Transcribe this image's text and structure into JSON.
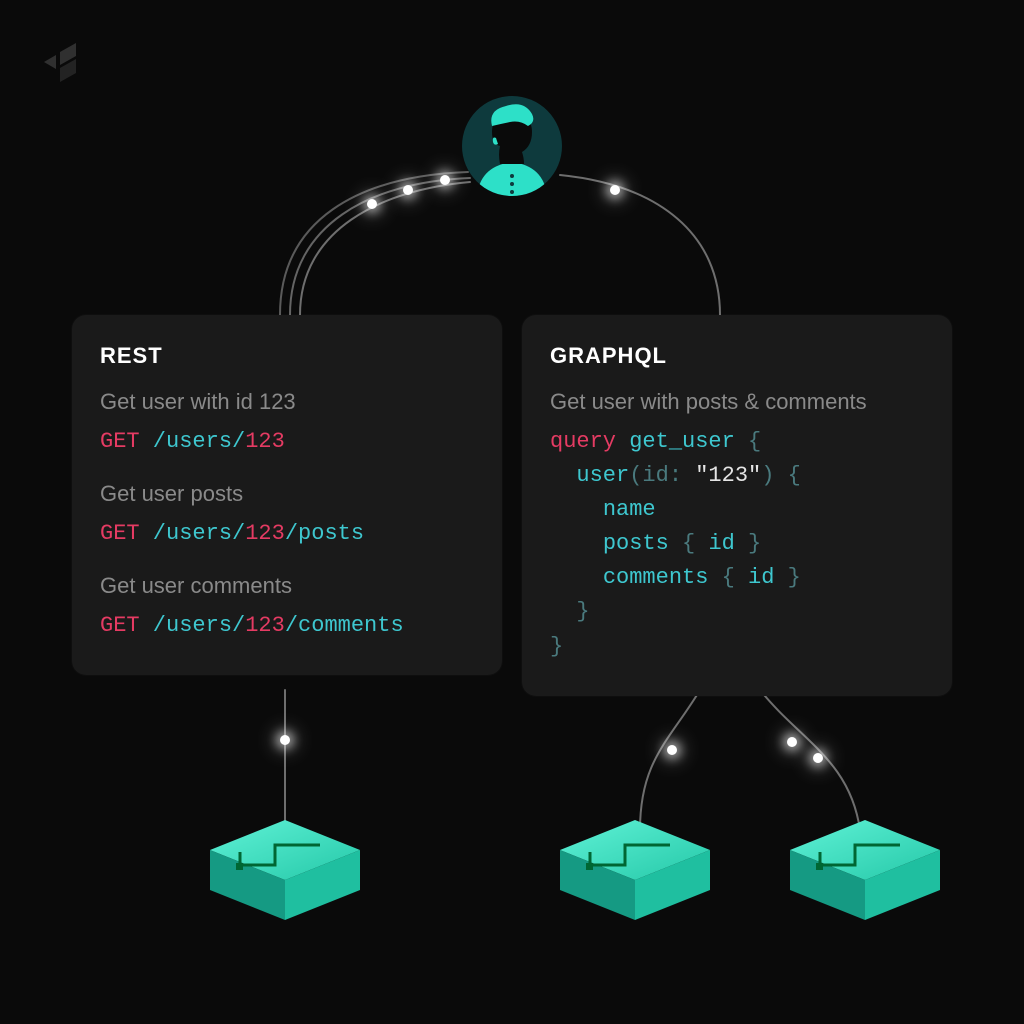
{
  "colors": {
    "bg": "#0a0a0a",
    "card_bg": "#1a1a1a",
    "text_muted": "#8a8a8a",
    "accent_red": "#e53b63",
    "accent_teal": "#3ec7cf",
    "brace": "#4a7a7e",
    "avatar_bg": "#0e3a3d",
    "avatar_accent": "#2de0c8",
    "server_top": "#3de9c8",
    "server_side": "#16a990"
  },
  "rest": {
    "title": "REST",
    "blocks": [
      {
        "desc": "Get user with id 123",
        "method": "GET",
        "segments": [
          " /users/",
          "123"
        ]
      },
      {
        "desc": "Get user posts",
        "method": "GET",
        "segments": [
          " /users/",
          "123",
          "/posts"
        ]
      },
      {
        "desc": "Get user comments",
        "method": "GET",
        "segments": [
          " /users/",
          "123",
          "/comments"
        ]
      }
    ]
  },
  "graphql": {
    "title": "GRAPHQL",
    "desc": "Get user with posts & comments",
    "lines": [
      [
        {
          "t": "key",
          "v": "query"
        },
        {
          "t": "plain",
          "v": " "
        },
        {
          "t": "ident",
          "v": "get_user"
        },
        {
          "t": "plain",
          "v": " "
        },
        {
          "t": "punc",
          "v": "{"
        }
      ],
      [
        {
          "t": "plain",
          "v": "  "
        },
        {
          "t": "ident",
          "v": "user"
        },
        {
          "t": "punc",
          "v": "(id: "
        },
        {
          "t": "str",
          "v": "\"123\""
        },
        {
          "t": "punc",
          "v": ")"
        },
        {
          "t": "plain",
          "v": " "
        },
        {
          "t": "punc",
          "v": "{"
        }
      ],
      [
        {
          "t": "plain",
          "v": "    "
        },
        {
          "t": "ident",
          "v": "name"
        }
      ],
      [
        {
          "t": "plain",
          "v": "    "
        },
        {
          "t": "ident",
          "v": "posts"
        },
        {
          "t": "plain",
          "v": " "
        },
        {
          "t": "punc",
          "v": "{"
        },
        {
          "t": "plain",
          "v": " "
        },
        {
          "t": "ident",
          "v": "id"
        },
        {
          "t": "plain",
          "v": " "
        },
        {
          "t": "punc",
          "v": "}"
        }
      ],
      [
        {
          "t": "plain",
          "v": "    "
        },
        {
          "t": "ident",
          "v": "comments"
        },
        {
          "t": "plain",
          "v": " "
        },
        {
          "t": "punc",
          "v": "{"
        },
        {
          "t": "plain",
          "v": " "
        },
        {
          "t": "ident",
          "v": "id"
        },
        {
          "t": "plain",
          "v": " "
        },
        {
          "t": "punc",
          "v": "}"
        }
      ],
      [
        {
          "t": "plain",
          "v": "  "
        },
        {
          "t": "punc",
          "v": "}"
        }
      ],
      [
        {
          "t": "punc",
          "v": "}"
        }
      ]
    ]
  }
}
